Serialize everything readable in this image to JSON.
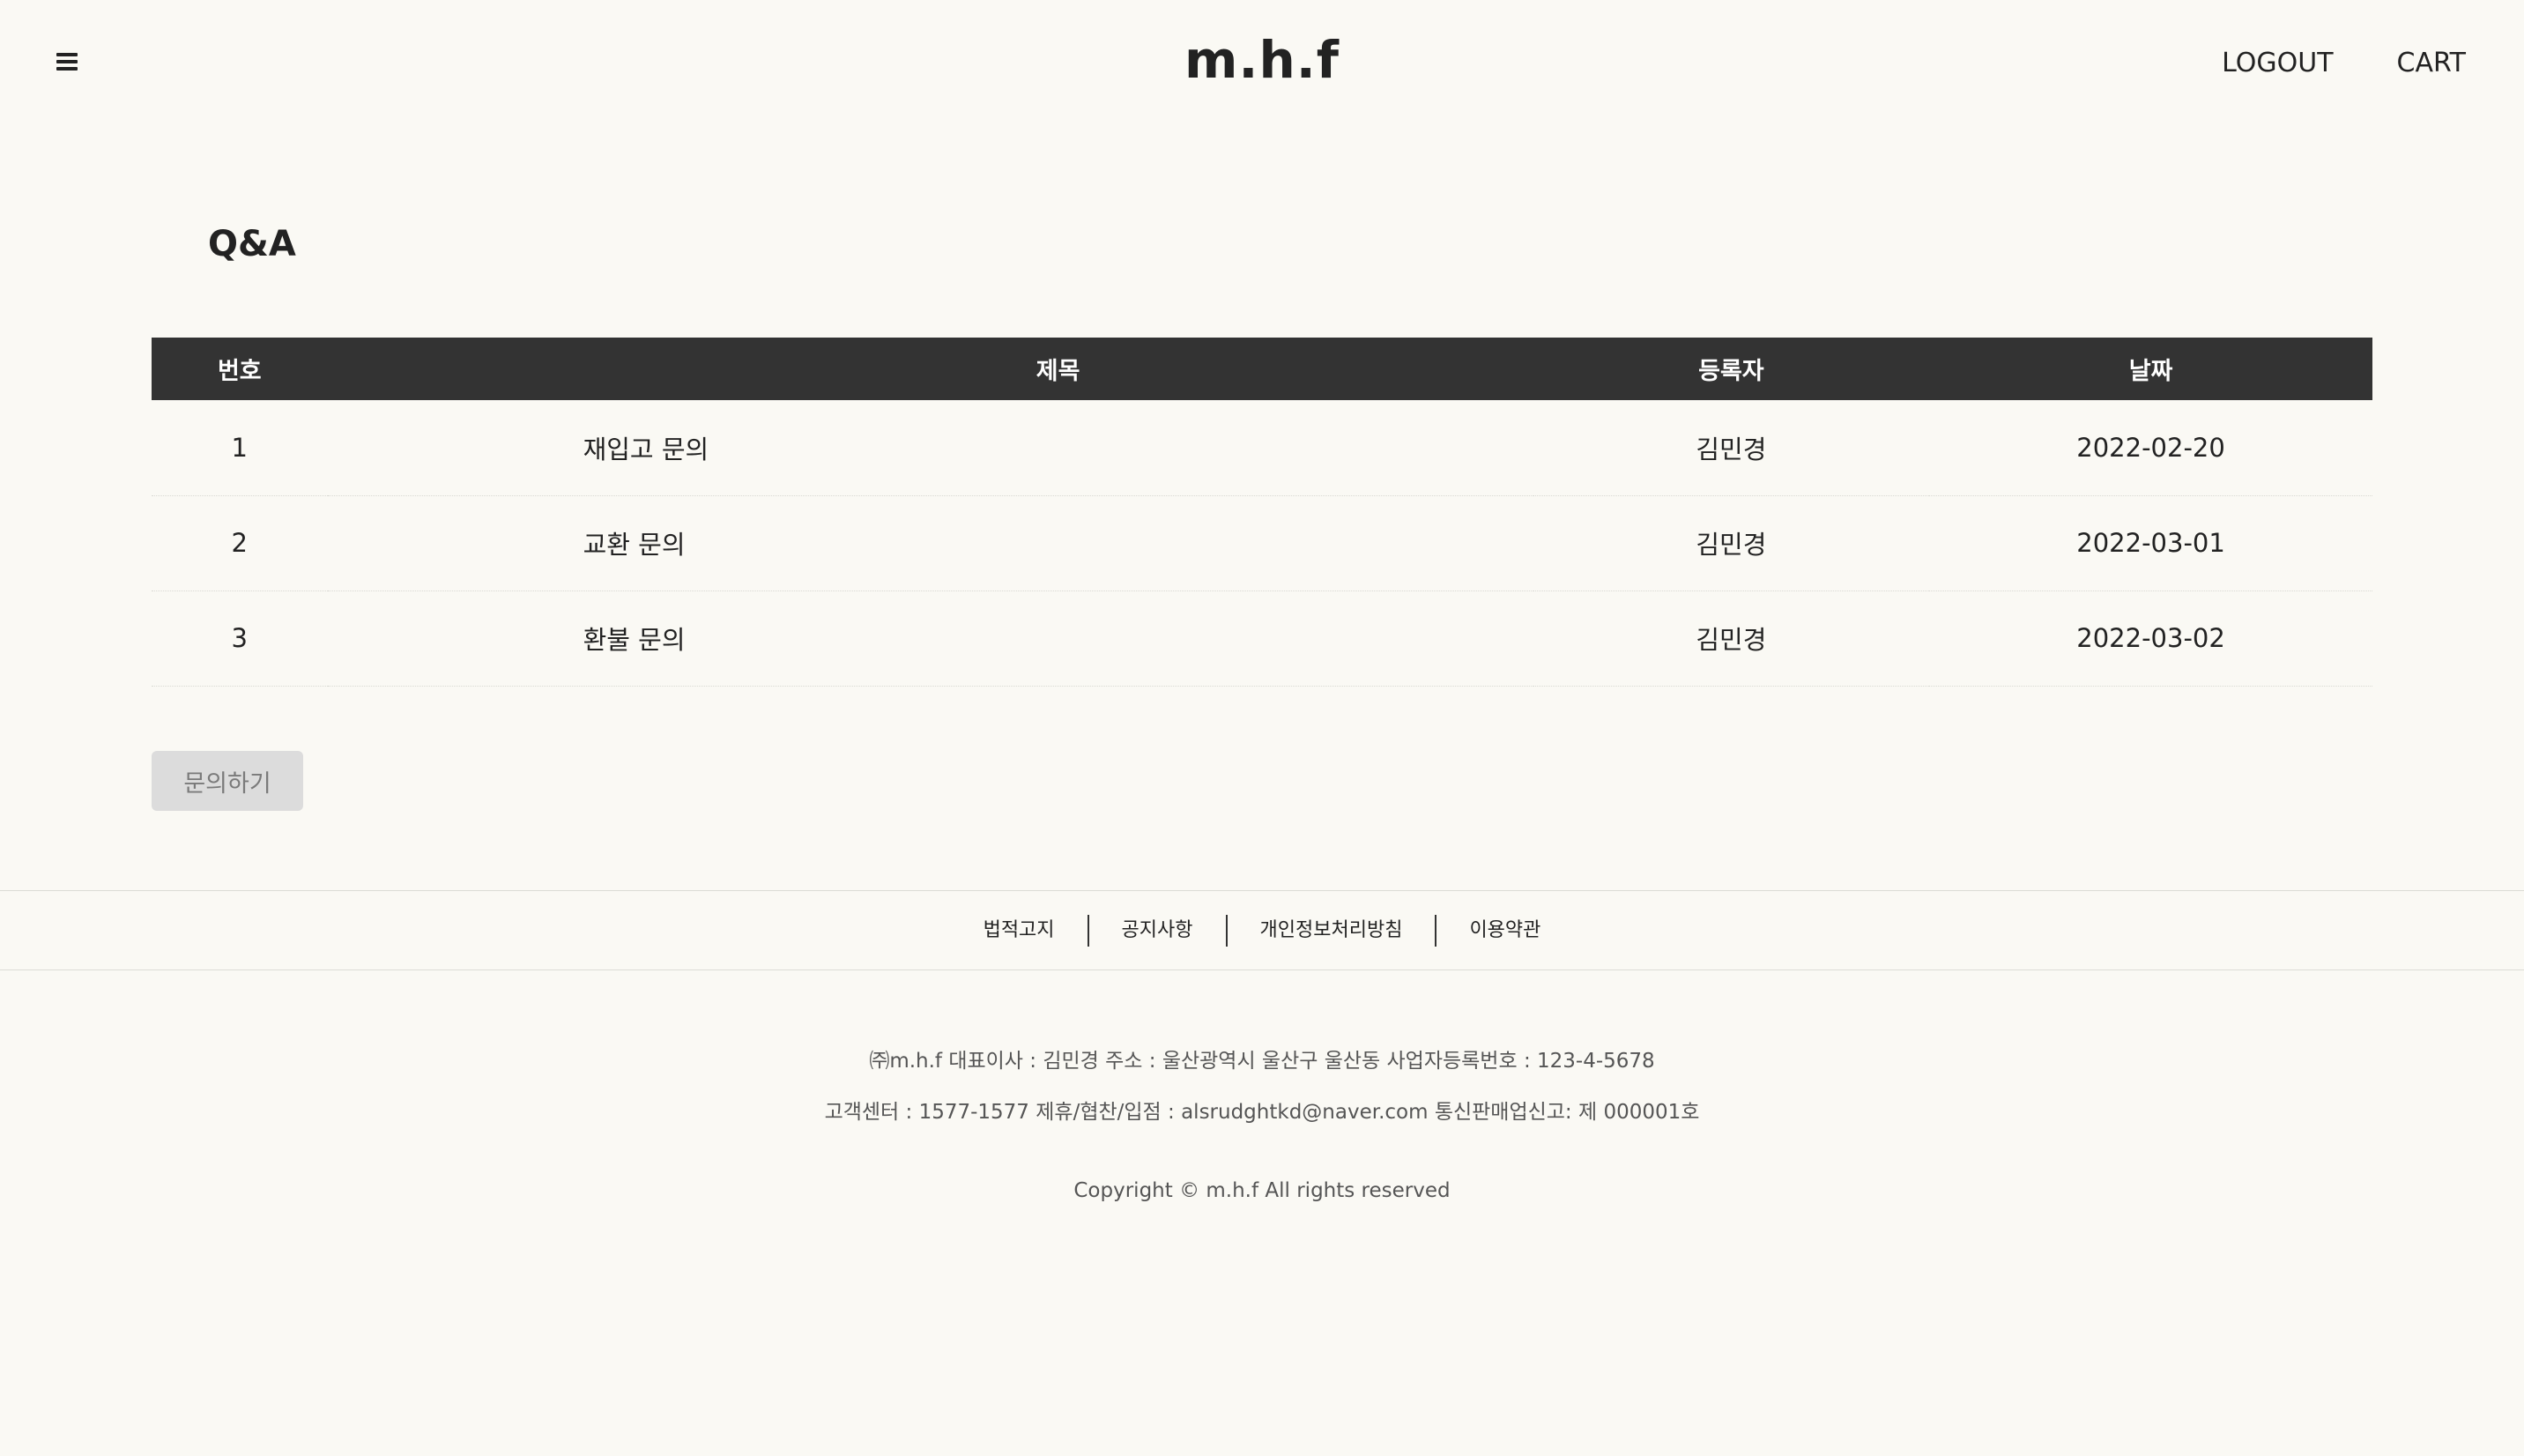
{
  "header": {
    "logo": "m.h.f",
    "logout_label": "LOGOUT",
    "cart_label": "CART",
    "menu_icon": "hamburger-menu-icon"
  },
  "main": {
    "title": "Q&A",
    "table": {
      "columns": [
        "번호",
        "제목",
        "등록자",
        "날짜"
      ],
      "rows": [
        {
          "no": "1",
          "title": "재입고 문의",
          "writer": "김민경",
          "date": "2022-02-20"
        },
        {
          "no": "2",
          "title": "교환 문의",
          "writer": "김민경",
          "date": "2022-03-01"
        },
        {
          "no": "3",
          "title": "환불 문의",
          "writer": "김민경",
          "date": "2022-03-02"
        }
      ]
    },
    "ask_button_label": "문의하기"
  },
  "footer": {
    "links": [
      "법적고지",
      "공지사항",
      "개인정보처리방침",
      "이용약관"
    ],
    "info_line1": "㈜m.h.f 대표이사 : 김민경 주소 : 울산광역시 울산구 울산동 사업자등록번호 : 123-4-5678",
    "info_line2": "고객센터 : 1577-1577 제휴/협찬/입점 : alsrudghtkd@naver.com 통신판매업신고: 제 000001호",
    "copyright": "Copyright © m.h.f All rights reserved"
  },
  "colors": {
    "background": "#faf9f4",
    "table_header_bg": "#333333",
    "button_bg": "#dcdcdc"
  }
}
